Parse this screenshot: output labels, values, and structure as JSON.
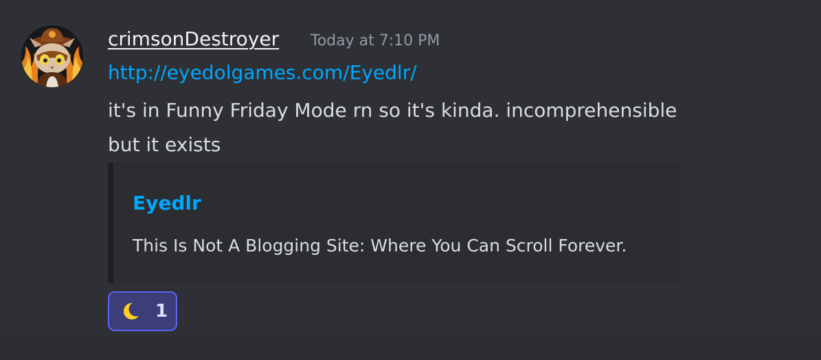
{
  "message": {
    "author": "crimsonDestroyer",
    "timestamp": "Today at 7:10 PM",
    "link": "http://eyedolgames.com/Eyedlr/",
    "content_line1": "it's in Funny Friday Mode rn so it's kinda. incomprehensible",
    "content_line2": "but it exists",
    "avatar_icon": "avatar-cat-character-icon"
  },
  "embed": {
    "title": "Eyedlr",
    "description": "This Is Not A Blogging Site: Where You Can Scroll Forever."
  },
  "reaction": {
    "emoji_icon": "crescent-moon-icon",
    "count": "1"
  },
  "colors": {
    "background": "#2b2d31",
    "message_hover": "#2e3035",
    "link": "#00a8fc",
    "username": "#f2f3f5",
    "text": "#dbdee1",
    "timestamp": "#949ba4",
    "reaction_border": "#5865f2",
    "reaction_bg": "#3b3e78"
  }
}
